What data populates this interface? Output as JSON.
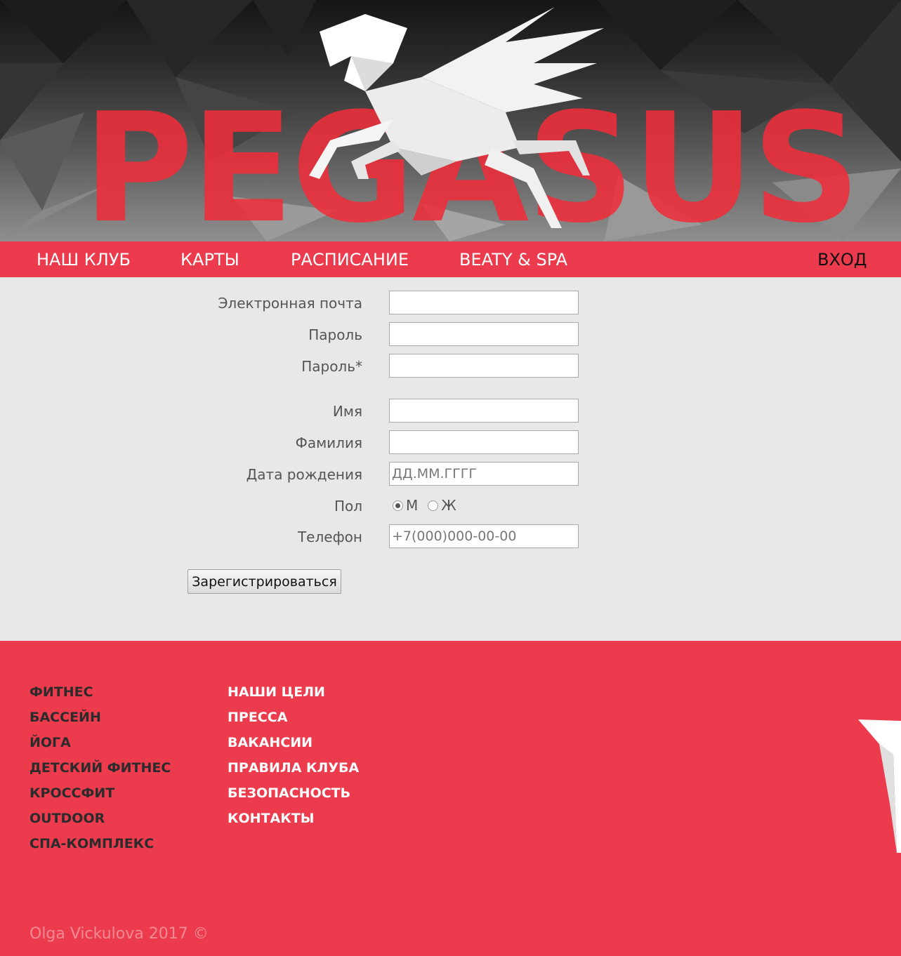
{
  "header": {
    "logo_text": "PEGASUS"
  },
  "nav": {
    "items": [
      {
        "label": "НАШ КЛУБ"
      },
      {
        "label": "КАРТЫ"
      },
      {
        "label": "РАСПИСАНИЕ"
      },
      {
        "label": "BEATY & SPA"
      }
    ],
    "login_label": "ВХОД"
  },
  "form": {
    "email_label": "Электронная почта",
    "email_value": "",
    "password_label": "Пароль",
    "password_value": "",
    "password_confirm_label": "Пароль*",
    "password_confirm_value": "",
    "first_name_label": "Имя",
    "first_name_value": "",
    "last_name_label": "Фамилия",
    "last_name_value": "",
    "birthdate_label": "Дата рождения",
    "birthdate_placeholder": "ДД.ММ.ГГГГ",
    "gender_label": "Пол",
    "gender_options": [
      {
        "label": "М",
        "checked": true
      },
      {
        "label": "Ж",
        "checked": false
      }
    ],
    "phone_label": "Телефон",
    "phone_placeholder": "+7(000)000-00-00",
    "submit_label": "Зарегистрироваться"
  },
  "footer": {
    "left_links": [
      "ФИТНЕС",
      "БАССЕЙН",
      "ЙОГА",
      "ДЕТСКИЙ ФИТНЕС",
      "КРОССФИТ",
      "OUTDOOR",
      "СПА-КОМПЛЕКС"
    ],
    "right_links": [
      "НАШИ ЦЕЛИ",
      "ПРЕССА",
      "ВАКАНСИИ",
      "ПРАВИЛА КЛУБА",
      "БЕЗОПАСНОСТЬ",
      "КОНТАКТЫ"
    ],
    "copyright": "Olga Vickulova 2017 ©"
  },
  "colors": {
    "accent": "#ed3b4e",
    "form_bg": "#e8e8e8",
    "logo_red": "#ee2e3a"
  }
}
